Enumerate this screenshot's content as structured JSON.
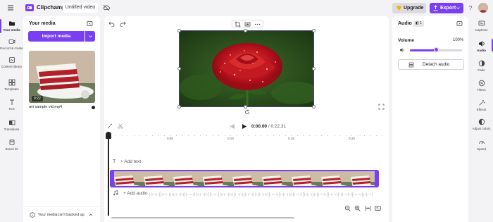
{
  "app": {
    "brand": "Clipchamp",
    "project_title": "Untitled video"
  },
  "header": {
    "upgrade_label": "Upgrade",
    "export_label": "Export",
    "help_label": "?"
  },
  "left_rail": {
    "items": [
      {
        "id": "your-media",
        "label": "Your media",
        "icon": "folder-icon",
        "active": true
      },
      {
        "id": "record-create",
        "label": "Record & create",
        "icon": "camera-icon"
      },
      {
        "id": "content-library",
        "label": "Content library",
        "icon": "library-icon"
      },
      {
        "id": "templates",
        "label": "Templates",
        "icon": "grid-icon"
      },
      {
        "id": "text",
        "label": "Text",
        "icon": "text-icon"
      },
      {
        "id": "transitions",
        "label": "Transitions",
        "icon": "transitions-icon"
      },
      {
        "id": "brand-kit",
        "label": "Brand kit",
        "icon": "brand-kit-icon"
      }
    ]
  },
  "media_panel": {
    "title": "Your media",
    "import_label": "Import media",
    "asset": {
      "name": "avi sample vid.mp4",
      "duration": "0:22"
    },
    "backup_text": "Your media isn't backed up"
  },
  "timeline": {
    "current_time": "0:00.00",
    "total_time": "/ 0:22.31",
    "ticks": [
      "0",
      "0:05",
      "0:10",
      "0:15",
      "0:20"
    ],
    "add_text_label": "+ Add text",
    "add_audio_label": "+ Add audio",
    "clip_frames": 9
  },
  "audio_panel": {
    "title": "Audio",
    "badge": "1",
    "volume_label": "Volume",
    "volume_value": "100%",
    "volume_level": 0.5,
    "detach_label": "Detach audio"
  },
  "right_rail": {
    "items": [
      {
        "id": "captions",
        "label": "Captions",
        "icon": "captions-icon"
      },
      {
        "id": "audio",
        "label": "Audio",
        "icon": "speaker-icon",
        "active": true
      },
      {
        "id": "fade",
        "label": "Fade",
        "icon": "fade-icon"
      },
      {
        "id": "filters",
        "label": "Filters",
        "icon": "filters-icon"
      },
      {
        "id": "effects",
        "label": "Effects",
        "icon": "effects-icon"
      },
      {
        "id": "adjust-colors",
        "label": "Adjust colors",
        "icon": "adjust-colors-icon"
      },
      {
        "id": "speed",
        "label": "Speed",
        "icon": "speed-icon"
      }
    ]
  },
  "colors": {
    "accent": "#7b3ff2",
    "background": "#f3f3f6",
    "panel": "#ffffff"
  }
}
